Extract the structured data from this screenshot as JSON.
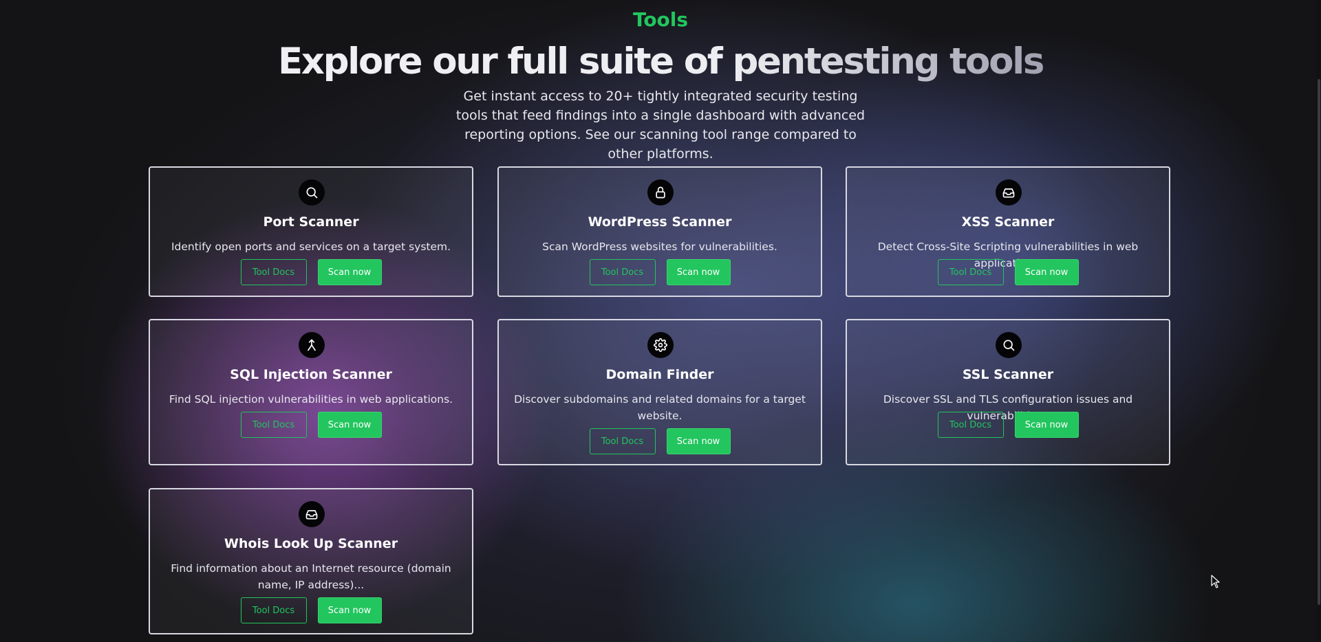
{
  "section": {
    "label": "Tools",
    "title": "Explore our full suite of pentesting tools",
    "description": "Get instant access to 20+ tightly integrated security testing tools that feed findings into a single dashboard with advanced reporting options. See our scanning tool range compared to other platforms."
  },
  "colors": {
    "accent": "#22c55e",
    "card_border": "#d9d9e3",
    "background": "#141416"
  },
  "tools": [
    {
      "icon": "search-icon",
      "title": "Port Scanner",
      "description": "Identify open ports and services on a target system.",
      "docs_label": "Tool Docs",
      "scan_label": "Scan now"
    },
    {
      "icon": "lock-icon",
      "title": "WordPress Scanner",
      "description": "Scan WordPress websites for vulnerabilities.",
      "docs_label": "Tool Docs",
      "scan_label": "Scan now"
    },
    {
      "icon": "inbox-icon",
      "title": "XSS Scanner",
      "description": "Detect Cross-Site Scripting vulnerabilities in web applications.",
      "docs_label": "Tool Docs",
      "scan_label": "Scan now"
    },
    {
      "icon": "merge-icon",
      "title": "SQL Injection Scanner",
      "description": "Find SQL injection vulnerabilities in web applications.",
      "docs_label": "Tool Docs",
      "scan_label": "Scan now"
    },
    {
      "icon": "gear-icon",
      "title": "Domain Finder",
      "description": "Discover subdomains and related domains for a target website.",
      "docs_label": "Tool Docs",
      "scan_label": "Scan now"
    },
    {
      "icon": "search-icon",
      "title": "SSL Scanner",
      "description": "Discover SSL and TLS configuration issues and vulnerabilities .",
      "docs_label": "Tool Docs",
      "scan_label": "Scan now"
    },
    {
      "icon": "inbox-icon",
      "title": "Whois Look Up Scanner",
      "description": "Find information about an Internet resource (domain name, IP address)...",
      "docs_label": "Tool Docs",
      "scan_label": "Scan now"
    }
  ]
}
